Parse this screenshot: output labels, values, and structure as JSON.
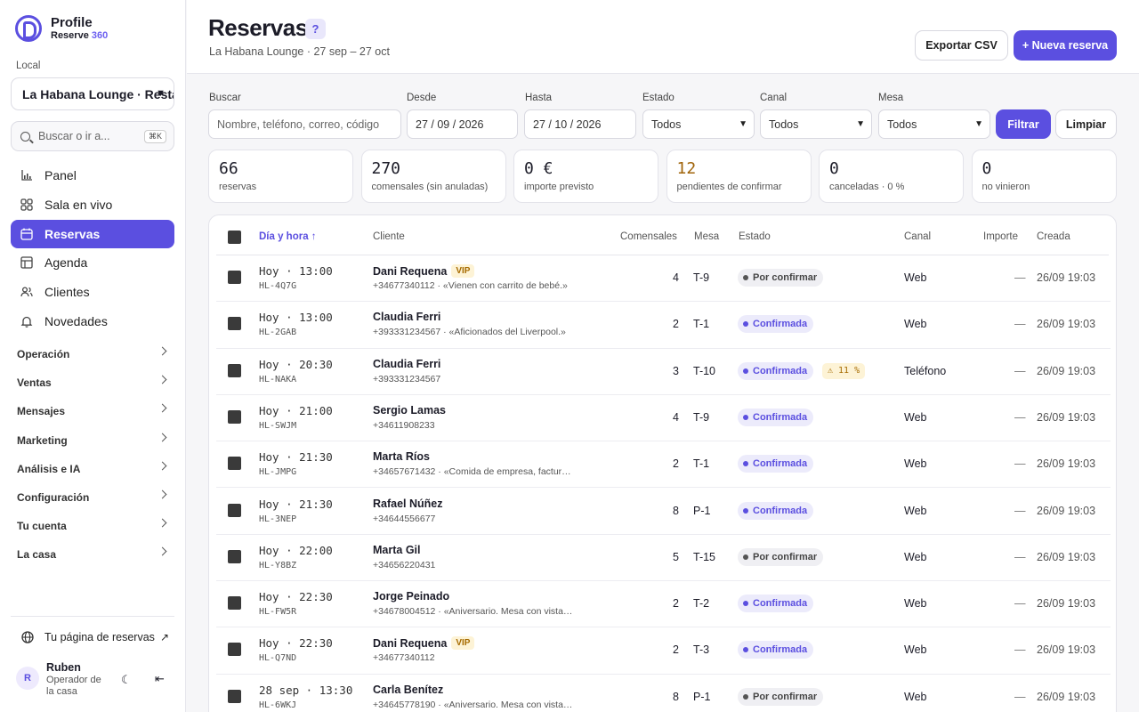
{
  "app": {
    "title": "Profile",
    "subtitle_prefix": "Reserve",
    "subtitle_accent": "360"
  },
  "sidebar": {
    "local_label": "Local",
    "local_value": "La Habana Lounge · Restaurante",
    "search_placeholder": "Buscar o ir a...",
    "search_shortcut": "⌘K",
    "nav": [
      {
        "label": "Panel",
        "icon": "chart-icon"
      },
      {
        "label": "Sala en vivo",
        "icon": "grid-icon"
      },
      {
        "label": "Reservas",
        "icon": "calendar-icon",
        "active": true
      },
      {
        "label": "Agenda",
        "icon": "table-icon"
      },
      {
        "label": "Clientes",
        "icon": "users-icon"
      },
      {
        "label": "Novedades",
        "icon": "bell-icon"
      }
    ],
    "groups": [
      "Operación",
      "Ventas",
      "Mensajes",
      "Marketing",
      "Análisis e IA",
      "Configuración",
      "Tu cuenta",
      "La casa"
    ],
    "public_link": "Tu página de reservas",
    "user": {
      "initial": "R",
      "name": "Ruben",
      "role": "Operador de la casa"
    }
  },
  "header": {
    "title": "Reservas",
    "help": "?",
    "subtitle": "La Habana Lounge · 27 sep – 27 oct",
    "export_label": "Exportar CSV",
    "new_label": "+ Nueva reserva"
  },
  "filters": {
    "search_label": "Buscar",
    "search_placeholder": "Nombre, teléfono, correo, código",
    "from_label": "Desde",
    "from_value": "27 / 09 / 2026",
    "to_label": "Hasta",
    "to_value": "27 / 10 / 2026",
    "status_label": "Estado",
    "status_value": "Todos",
    "channel_label": "Canal",
    "channel_value": "Todos",
    "table_label": "Mesa",
    "table_value": "Todos",
    "filter_btn": "Filtrar",
    "clear_btn": "Limpiar"
  },
  "stats": [
    {
      "value": "66",
      "label": "reservas"
    },
    {
      "value": "270",
      "label": "comensales (sin anuladas)"
    },
    {
      "value": "0 €",
      "label": "importe previsto"
    },
    {
      "value": "12",
      "label": "pendientes de confirmar",
      "color": "#a0640a"
    },
    {
      "value": "0",
      "label": "canceladas · 0 %"
    },
    {
      "value": "0",
      "label": "no vinieron"
    }
  ],
  "table": {
    "headers": {
      "date": "Día y hora ↑",
      "client": "Cliente",
      "guests": "Comensales",
      "table": "Mesa",
      "status": "Estado",
      "channel": "Canal",
      "amount": "Importe",
      "created": "Creada"
    },
    "rows": [
      {
        "time": "Hoy · 13:00",
        "code": "HL-4Q7G",
        "name": "Dani Requena",
        "vip": "VIP",
        "sub": "+34677340112 · «Vienen con carrito de bebé.»",
        "guests": "4",
        "table": "T-9",
        "status": "Por confirmar",
        "kind": "pending",
        "channel": "Web",
        "amount": "—",
        "created": "26/09 19:03"
      },
      {
        "time": "Hoy · 13:00",
        "code": "HL-2GAB",
        "name": "Claudia Ferri",
        "sub": "+393331234567 · «Aficionados del Liverpool.»",
        "guests": "2",
        "table": "T-1",
        "status": "Confirmada",
        "kind": "confirmed",
        "channel": "Web",
        "amount": "—",
        "created": "26/09 19:03"
      },
      {
        "time": "Hoy · 20:30",
        "code": "HL-NAKA",
        "name": "Claudia Ferri",
        "sub": "+393331234567",
        "guests": "3",
        "table": "T-10",
        "status": "Confirmada",
        "kind": "confirmed",
        "warn": "⚠ 11 %",
        "channel": "Teléfono",
        "amount": "—",
        "created": "26/09 19:03"
      },
      {
        "time": "Hoy · 21:00",
        "code": "HL-SWJM",
        "name": "Sergio Lamas",
        "sub": "+34611908233",
        "guests": "4",
        "table": "T-9",
        "status": "Confirmada",
        "kind": "confirmed",
        "channel": "Web",
        "amount": "—",
        "created": "26/09 19:03"
      },
      {
        "time": "Hoy · 21:30",
        "code": "HL-JMPG",
        "name": "Marta Ríos",
        "sub": "+34657671432 · «Comida de empresa, factur…",
        "guests": "2",
        "table": "T-1",
        "status": "Confirmada",
        "kind": "confirmed",
        "channel": "Web",
        "amount": "—",
        "created": "26/09 19:03"
      },
      {
        "time": "Hoy · 21:30",
        "code": "HL-3NEP",
        "name": "Rafael Núñez",
        "sub": "+34644556677",
        "guests": "8",
        "table": "P-1",
        "status": "Confirmada",
        "kind": "confirmed",
        "channel": "Web",
        "amount": "—",
        "created": "26/09 19:03"
      },
      {
        "time": "Hoy · 22:00",
        "code": "HL-Y8BZ",
        "name": "Marta Gil",
        "sub": "+34656220431",
        "guests": "5",
        "table": "T-15",
        "status": "Por confirmar",
        "kind": "pending",
        "channel": "Web",
        "amount": "—",
        "created": "26/09 19:03"
      },
      {
        "time": "Hoy · 22:30",
        "code": "HL-FW5R",
        "name": "Jorge Peinado",
        "sub": "+34678004512 · «Aniversario. Mesa con vista…",
        "guests": "2",
        "table": "T-2",
        "status": "Confirmada",
        "kind": "confirmed",
        "channel": "Web",
        "amount": "—",
        "created": "26/09 19:03"
      },
      {
        "time": "Hoy · 22:30",
        "code": "HL-Q7ND",
        "name": "Dani Requena",
        "vip": "VIP",
        "sub": "+34677340112",
        "guests": "2",
        "table": "T-3",
        "status": "Confirmada",
        "kind": "confirmed",
        "channel": "Web",
        "amount": "—",
        "created": "26/09 19:03"
      },
      {
        "time": "28 sep · 13:30",
        "code": "HL-6WKJ",
        "name": "Carla Benítez",
        "sub": "+34645778190 · «Aniversario. Mesa con vista…",
        "guests": "8",
        "table": "P-1",
        "status": "Por confirmar",
        "kind": "pending",
        "channel": "Web",
        "amount": "—",
        "created": "26/09 19:03"
      }
    ]
  }
}
